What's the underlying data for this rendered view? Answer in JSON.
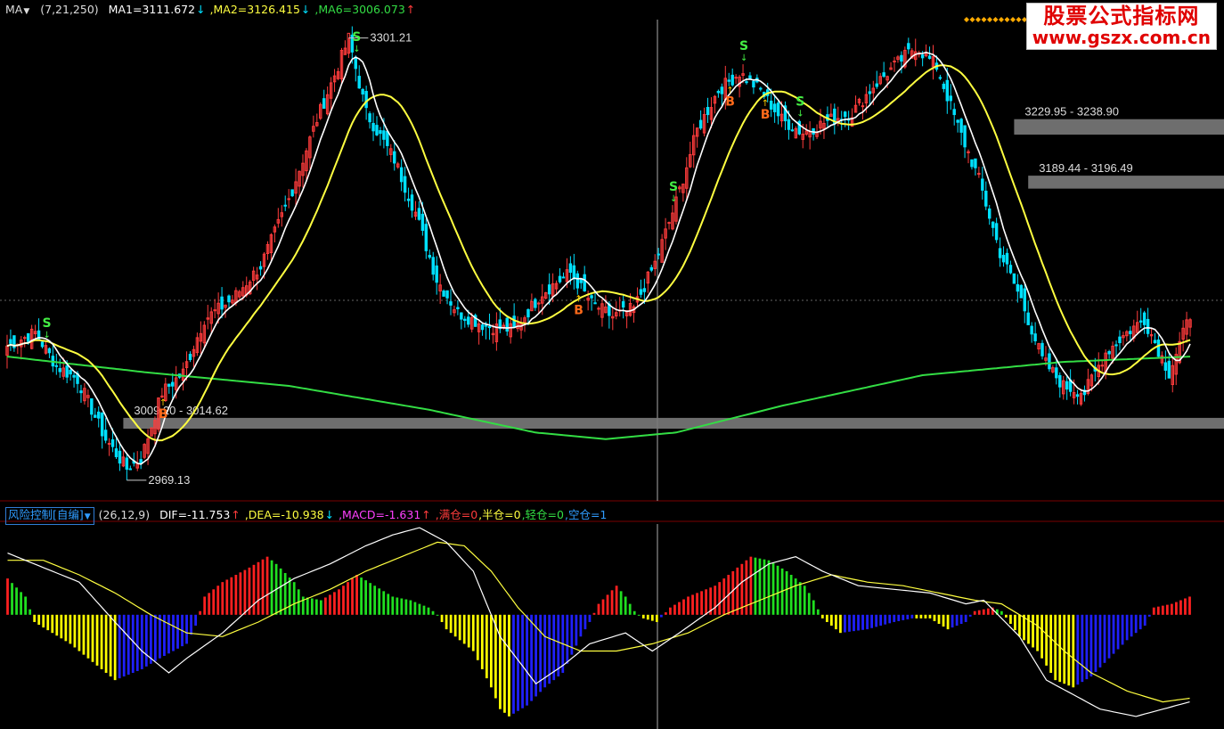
{
  "header_top": {
    "indicator_name": "MA",
    "params": "(7,21,250)",
    "ma1": "MA1=3111.672",
    "ma1_arrow": "↓",
    "ma2": ",MA2=3126.415",
    "ma2_arrow": "↓",
    "ma6": ",MA6=3006.073",
    "ma6_arrow": "↑"
  },
  "header_bottom": {
    "indicator_name": "风险控制[自编]",
    "params": "(26,12,9)",
    "dif": "DIF=-11.753",
    "dif_arrow": "↑",
    "dea": ",DEA=-10.938",
    "dea_arrow": "↓",
    "macd": ",MACD=-1.631",
    "macd_arrow": "↑",
    "full": ",满仓=0",
    "half": ",半仓=0",
    "light": ",轻仓=0",
    "empty": ",空仓=1"
  },
  "watermark": {
    "title": "股票公式指标网",
    "url": "www.gszx.com.cn"
  },
  "colors": {
    "background": "#000000",
    "up_candle": "#ff3c3c",
    "down_candle": "#00e0ff",
    "ma_short": "#ffffff",
    "ma_mid": "#ffff40",
    "ma_long": "#33dd44",
    "band": "#7a7a7a",
    "macd_red": "#ff2020",
    "macd_green": "#20e020",
    "macd_yellow": "#ffff00",
    "macd_blue": "#2020ff",
    "signal_sell": "#44ee44",
    "signal_buy": "#ff6a1a"
  },
  "chart_data": [
    {
      "type": "candlestick",
      "title": "",
      "series_ma": [
        {
          "name": "MA1",
          "period": 7,
          "last": 3111.672,
          "color": "white"
        },
        {
          "name": "MA2",
          "period": 21,
          "last": 3126.415,
          "color": "yellow"
        },
        {
          "name": "MA6",
          "period": 250,
          "last": 3006.073,
          "color": "green"
        }
      ],
      "ylim": [
        2955,
        3315
      ],
      "high_label": "3301.21",
      "low_label": "2969.13",
      "price_bands": [
        {
          "label": "3009.20 - 3014.62",
          "low": 3009.2,
          "high": 3014.62
        },
        {
          "label": "3189.44 - 3196.49",
          "low": 3189.44,
          "high": 3196.49
        },
        {
          "label": "3229.95 - 3238.90",
          "low": 3229.95,
          "high": 3238.9
        }
      ],
      "signals": [
        {
          "type": "S",
          "index": 11
        },
        {
          "type": "B",
          "index": 44
        },
        {
          "type": "S",
          "index": 99
        },
        {
          "type": "B",
          "index": 162
        },
        {
          "type": "S",
          "index": 189
        },
        {
          "type": "B",
          "index": 205
        },
        {
          "type": "S",
          "index": 209
        },
        {
          "type": "B",
          "index": 215
        },
        {
          "type": "S",
          "index": 225
        }
      ],
      "key_points": [
        [
          0,
          3070
        ],
        [
          8,
          3080
        ],
        [
          14,
          3055
        ],
        [
          20,
          3045
        ],
        [
          28,
          3000
        ],
        [
          34,
          2978
        ],
        [
          38,
          2985
        ],
        [
          44,
          3035
        ],
        [
          50,
          3050
        ],
        [
          56,
          3090
        ],
        [
          64,
          3105
        ],
        [
          72,
          3130
        ],
        [
          80,
          3180
        ],
        [
          88,
          3240
        ],
        [
          94,
          3280
        ],
        [
          97,
          3301
        ],
        [
          102,
          3245
        ],
        [
          110,
          3210
        ],
        [
          116,
          3170
        ],
        [
          122,
          3120
        ],
        [
          128,
          3095
        ],
        [
          136,
          3085
        ],
        [
          144,
          3082
        ],
        [
          152,
          3110
        ],
        [
          160,
          3125
        ],
        [
          166,
          3102
        ],
        [
          172,
          3092
        ],
        [
          178,
          3098
        ],
        [
          184,
          3132
        ],
        [
          190,
          3178
        ],
        [
          196,
          3232
        ],
        [
          202,
          3262
        ],
        [
          208,
          3275
        ],
        [
          214,
          3262
        ],
        [
          220,
          3240
        ],
        [
          226,
          3230
        ],
        [
          234,
          3240
        ],
        [
          240,
          3245
        ],
        [
          246,
          3265
        ],
        [
          252,
          3280
        ],
        [
          258,
          3295
        ],
        [
          264,
          3280
        ],
        [
          270,
          3235
        ],
        [
          276,
          3195
        ],
        [
          282,
          3140
        ],
        [
          288,
          3105
        ],
        [
          294,
          3060
        ],
        [
          300,
          3040
        ],
        [
          306,
          3035
        ],
        [
          312,
          3065
        ],
        [
          318,
          3080
        ],
        [
          323,
          3090
        ],
        [
          330,
          3050
        ],
        [
          336,
          3093
        ]
      ]
    },
    {
      "type": "macd",
      "params": [
        26,
        12,
        9
      ],
      "dif": -11.753,
      "dea": -10.938,
      "macd": -1.631,
      "ylim": [
        -30,
        25
      ],
      "hist_key_points": [
        [
          0,
          10
        ],
        [
          4,
          5
        ],
        [
          6,
          -2
        ],
        [
          10,
          -5
        ],
        [
          14,
          -8
        ],
        [
          18,
          -12
        ],
        [
          20,
          -14
        ],
        [
          24,
          -18
        ],
        [
          26,
          -17
        ],
        [
          30,
          -15
        ],
        [
          34,
          -12
        ],
        [
          40,
          -8
        ],
        [
          42,
          -3
        ],
        [
          44,
          5
        ],
        [
          48,
          9
        ],
        [
          54,
          13
        ],
        [
          58,
          16
        ],
        [
          60,
          14
        ],
        [
          64,
          9
        ],
        [
          66,
          5
        ],
        [
          70,
          4
        ],
        [
          74,
          7
        ],
        [
          78,
          11
        ],
        [
          82,
          8
        ],
        [
          86,
          5
        ],
        [
          90,
          4
        ],
        [
          94,
          2
        ],
        [
          96,
          0
        ],
        [
          98,
          -4
        ],
        [
          104,
          -10
        ],
        [
          108,
          -20
        ],
        [
          110,
          -26
        ],
        [
          112,
          -28
        ],
        [
          116,
          -25
        ],
        [
          120,
          -20
        ],
        [
          124,
          -16
        ],
        [
          128,
          -6
        ],
        [
          130,
          -2
        ],
        [
          132,
          3
        ],
        [
          136,
          8
        ],
        [
          138,
          5
        ],
        [
          140,
          1
        ],
        [
          142,
          -1
        ],
        [
          145,
          -2
        ],
        [
          148,
          2
        ],
        [
          152,
          5
        ],
        [
          158,
          8
        ],
        [
          162,
          12
        ],
        [
          166,
          16
        ],
        [
          170,
          15
        ],
        [
          174,
          12
        ],
        [
          178,
          8
        ],
        [
          180,
          4
        ],
        [
          182,
          -1
        ],
        [
          186,
          -5
        ],
        [
          192,
          -4
        ],
        [
          198,
          -2
        ],
        [
          202,
          -1
        ],
        [
          206,
          -1
        ],
        [
          210,
          -4
        ],
        [
          214,
          -2
        ],
        [
          216,
          1
        ],
        [
          220,
          2
        ],
        [
          222,
          1
        ],
        [
          226,
          -6
        ],
        [
          230,
          -10
        ],
        [
          234,
          -18
        ],
        [
          238,
          -20
        ],
        [
          242,
          -17
        ],
        [
          246,
          -12
        ],
        [
          250,
          -7
        ],
        [
          254,
          -3
        ],
        [
          256,
          2
        ],
        [
          260,
          3
        ],
        [
          264,
          5
        ]
      ],
      "dif_key_points": [
        [
          0,
          17
        ],
        [
          8,
          13
        ],
        [
          16,
          9
        ],
        [
          24,
          -2
        ],
        [
          30,
          -10
        ],
        [
          36,
          -16
        ],
        [
          40,
          -12
        ],
        [
          48,
          -5
        ],
        [
          56,
          4
        ],
        [
          64,
          10
        ],
        [
          72,
          14
        ],
        [
          80,
          19
        ],
        [
          86,
          22
        ],
        [
          92,
          24
        ],
        [
          98,
          20
        ],
        [
          104,
          12
        ],
        [
          110,
          -6
        ],
        [
          118,
          -19
        ],
        [
          124,
          -14
        ],
        [
          130,
          -8
        ],
        [
          138,
          -5
        ],
        [
          144,
          -10
        ],
        [
          150,
          -5
        ],
        [
          158,
          2
        ],
        [
          164,
          9
        ],
        [
          170,
          14
        ],
        [
          176,
          16
        ],
        [
          182,
          12
        ],
        [
          190,
          8
        ],
        [
          198,
          7
        ],
        [
          206,
          6
        ],
        [
          214,
          3
        ],
        [
          218,
          4
        ],
        [
          226,
          -6
        ],
        [
          232,
          -18
        ],
        [
          238,
          -22
        ],
        [
          244,
          -26
        ],
        [
          252,
          -28
        ],
        [
          258,
          -26
        ],
        [
          264,
          -24
        ],
        [
          268,
          -20
        ]
      ],
      "dea_key_points": [
        [
          0,
          15
        ],
        [
          8,
          15
        ],
        [
          16,
          11
        ],
        [
          24,
          6
        ],
        [
          32,
          0
        ],
        [
          40,
          -5
        ],
        [
          48,
          -6
        ],
        [
          56,
          -2
        ],
        [
          64,
          3
        ],
        [
          72,
          7
        ],
        [
          80,
          12
        ],
        [
          88,
          16
        ],
        [
          96,
          20
        ],
        [
          102,
          19
        ],
        [
          108,
          12
        ],
        [
          114,
          2
        ],
        [
          120,
          -6
        ],
        [
          128,
          -10
        ],
        [
          136,
          -10
        ],
        [
          144,
          -8
        ],
        [
          152,
          -5
        ],
        [
          160,
          0
        ],
        [
          168,
          4
        ],
        [
          176,
          8
        ],
        [
          184,
          11
        ],
        [
          192,
          9
        ],
        [
          200,
          8
        ],
        [
          208,
          6
        ],
        [
          216,
          4
        ],
        [
          222,
          3
        ],
        [
          230,
          -3
        ],
        [
          236,
          -10
        ],
        [
          242,
          -16
        ],
        [
          250,
          -21
        ],
        [
          258,
          -24
        ],
        [
          264,
          -23
        ],
        [
          268,
          -22
        ]
      ]
    }
  ]
}
